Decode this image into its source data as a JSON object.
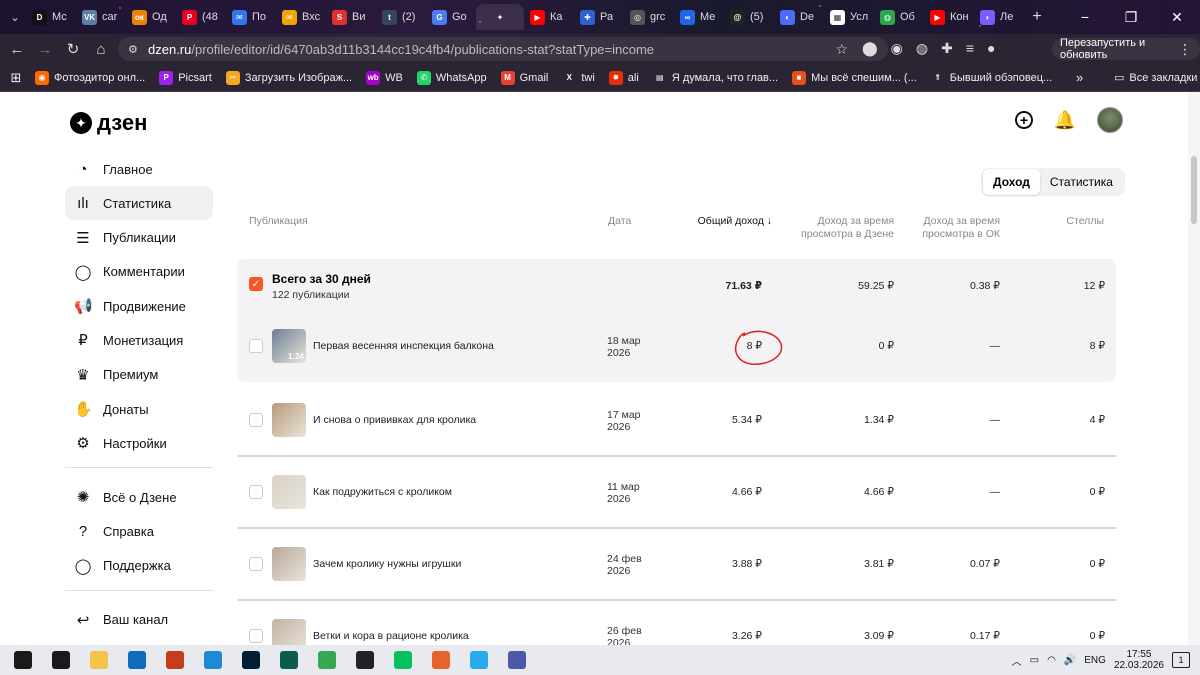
{
  "browser": {
    "tabs": [
      {
        "label": "Мс",
        "icon": "dzen-icon",
        "color": "#111111",
        "glyph": "D"
      },
      {
        "label": "car",
        "icon": "vk-icon",
        "color": "#5b7fa6",
        "glyph": "VK"
      },
      {
        "label": "Од",
        "icon": "ok-icon",
        "color": "#ee8208",
        "glyph": "ок"
      },
      {
        "label": "(48",
        "icon": "pinterest-icon",
        "color": "#e60023",
        "glyph": "P"
      },
      {
        "label": "По",
        "icon": "mail-icon",
        "color": "#3474f0",
        "glyph": "✉"
      },
      {
        "label": "Вхс",
        "icon": "yandex-mail-icon",
        "color": "#f0a500",
        "glyph": "✉"
      },
      {
        "label": "Ви",
        "icon": "s-icon",
        "color": "#e03030",
        "glyph": "S"
      },
      {
        "label": "(2)",
        "icon": "tumblr-icon",
        "color": "#35465c",
        "glyph": "t"
      },
      {
        "label": "Gо",
        "icon": "translate-icon",
        "color": "#4a7bf0",
        "glyph": "G"
      },
      {
        "label": "",
        "icon": "star-tab-icon",
        "color": "#3b2f4a",
        "glyph": "✦",
        "active": true
      },
      {
        "label": "Ка",
        "icon": "youtube-icon",
        "color": "#ff0000",
        "glyph": "▶"
      },
      {
        "label": "Ра",
        "icon": "puzzle-icon",
        "color": "#2a62d6",
        "glyph": "✚"
      },
      {
        "label": "grc",
        "icon": "grok-icon",
        "color": "#555555",
        "glyph": "◎"
      },
      {
        "label": "Ме",
        "icon": "meta-icon",
        "color": "#2166e8",
        "glyph": "∞"
      },
      {
        "label": "(5)",
        "icon": "threads-icon",
        "color": "#222222",
        "glyph": "@"
      },
      {
        "label": "De",
        "icon": "deepseek-icon",
        "color": "#4b6bfb",
        "glyph": "◐"
      },
      {
        "label": "Усл",
        "icon": "doc-icon",
        "color": "#ffffff",
        "glyph": "▦"
      },
      {
        "label": "Об",
        "icon": "apps-icon",
        "color": "#2ca84c",
        "glyph": "◍"
      },
      {
        "label": "Кон",
        "icon": "youtube-icon",
        "color": "#ff0000",
        "glyph": "▶"
      },
      {
        "label": "Ле",
        "icon": "alice-icon",
        "color": "#7b5cff",
        "glyph": "◗"
      }
    ],
    "url_host": "dzen.ru",
    "url_path": "/profile/editor/id/6470ab3d11b3144cc19c4fb4/publications-stat?statType=income",
    "relaunch_label": "Перезапустить и обновить",
    "bookmarks": [
      {
        "label": "Фотоэдитор онл...",
        "color": "#ff6a00",
        "glyph": "◉",
        "icon": "photo-editor-icon"
      },
      {
        "label": "Picsart",
        "color": "#a020f0",
        "glyph": "P",
        "icon": "picsart-icon"
      },
      {
        "label": "Загрузить Изображ...",
        "color": "#f5a623",
        "glyph": "✂",
        "icon": "scissors-icon"
      },
      {
        "label": "WB",
        "color": "#a300c8",
        "glyph": "wb",
        "icon": "wildberries-icon"
      },
      {
        "label": "WhatsApp",
        "color": "#25d366",
        "glyph": "✆",
        "icon": "whatsapp-icon"
      },
      {
        "label": "Gmail",
        "color": "#e94235",
        "glyph": "M",
        "icon": "gmail-icon"
      },
      {
        "label": "twi",
        "color": "#2b2533",
        "glyph": "X",
        "icon": "x-icon"
      },
      {
        "label": "ali",
        "color": "#e62e04",
        "glyph": "✸",
        "icon": "aliexpress-icon"
      },
      {
        "label": "Я думала, что глав...",
        "color": "#2b2533",
        "glyph": "▤",
        "icon": "grid-icon"
      },
      {
        "label": "Мы всё спешим... (...",
        "color": "#e8501a",
        "glyph": "■",
        "icon": "square-icon"
      },
      {
        "label": "Бывший обэповец...",
        "color": "#2b2533",
        "glyph": "⇑",
        "icon": "chevrons-icon"
      }
    ],
    "all_bookmarks_label": "Все закладки"
  },
  "app": {
    "logo_text": "дзен",
    "sidebar": [
      {
        "label": "Главное",
        "icon": "planet-icon",
        "glyph": "◔"
      },
      {
        "label": "Статистика",
        "icon": "bar-chart-icon",
        "glyph": "ılı",
        "active": true
      },
      {
        "label": "Публикации",
        "icon": "stack-icon",
        "glyph": "☰"
      },
      {
        "label": "Комментарии",
        "icon": "comment-icon",
        "glyph": "◯"
      },
      {
        "label": "Продвижение",
        "icon": "megaphone-icon",
        "glyph": "📢"
      },
      {
        "label": "Монетизация",
        "icon": "ruble-icon",
        "glyph": "₽"
      },
      {
        "label": "Премиум",
        "icon": "crown-icon",
        "glyph": "♛"
      },
      {
        "label": "Донаты",
        "icon": "hand-coin-icon",
        "glyph": "✋"
      },
      {
        "label": "Настройки",
        "icon": "gear-icon",
        "glyph": "⚙"
      }
    ],
    "sidebar_secondary": [
      {
        "label": "Всё о Дзене",
        "icon": "flame-icon",
        "glyph": "✺"
      },
      {
        "label": "Справка",
        "icon": "help-icon",
        "glyph": "?"
      },
      {
        "label": "Поддержка",
        "icon": "chat-icon",
        "glyph": "◯"
      }
    ],
    "sidebar_channel": {
      "label": "Ваш канал",
      "icon": "return-icon",
      "glyph": "↩"
    },
    "toggle": {
      "income": "Доход",
      "stats": "Статистика"
    }
  },
  "table": {
    "headers": {
      "publication": "Публикация",
      "date": "Дата",
      "total_income": "Общий доход",
      "dzen_view": "Доход за время\nпросмотра в Дзене",
      "ok_view": "Доход за время\nпросмотра в ОК",
      "stella": "Стеллы"
    },
    "total": {
      "title": "Всего за 30 дней",
      "subtitle": "122 публикации",
      "total_income": "71.63 ₽",
      "dzen_view": "59.25 ₽",
      "ok_view": "0.38 ₽",
      "stella": "12 ₽"
    },
    "rows": [
      {
        "title": "Первая весенняя инспекция балкона",
        "date_day": "18 мар",
        "date_year": "2026",
        "total_income": "8 ₽",
        "dzen_view": "0 ₽",
        "ok_view": "—",
        "stella": "8 ₽",
        "duration": "1:24",
        "thumb_color": "#6c7e93",
        "highlighted": true
      },
      {
        "title": "И снова о прививках для кролика",
        "date_day": "17 мар",
        "date_year": "2026",
        "total_income": "5.34 ₽",
        "dzen_view": "1.34 ₽",
        "ok_view": "—",
        "stella": "4 ₽",
        "thumb_color": "#b89a78"
      },
      {
        "title": "Как подружиться с кроликом",
        "date_day": "11 мар",
        "date_year": "2026",
        "total_income": "4.66 ₽",
        "dzen_view": "4.66 ₽",
        "ok_view": "—",
        "stella": "0 ₽",
        "thumb_color": "#d8d2c8"
      },
      {
        "title": "Зачем кролику нужны игрушки",
        "date_day": "24 фев",
        "date_year": "2026",
        "total_income": "3.88 ₽",
        "dzen_view": "3.81 ₽",
        "ok_view": "0.07 ₽",
        "stella": "0 ₽",
        "thumb_color": "#b8a89a"
      },
      {
        "title": "Ветки и кора в рационе кролика",
        "date_day": "26 фев",
        "date_year": "2026",
        "total_income": "3.26 ₽",
        "dzen_view": "3.09 ₽",
        "ok_view": "0.17 ₽",
        "stella": "0 ₽",
        "thumb_color": "#c4b2a0"
      }
    ]
  },
  "taskbar": {
    "apps": [
      {
        "icon": "start-icon",
        "color": "#1a1a1a"
      },
      {
        "icon": "task-view-icon",
        "color": "#1a1a1a"
      },
      {
        "icon": "file-explorer-icon",
        "color": "#f3c34b"
      },
      {
        "icon": "outlook-icon",
        "color": "#0f6cbd"
      },
      {
        "icon": "powerpoint-icon",
        "color": "#c43e1c"
      },
      {
        "icon": "edge-icon",
        "color": "#1e8ad6"
      },
      {
        "icon": "lightroom-icon",
        "color": "#001e36"
      },
      {
        "icon": "app-icon",
        "color": "#0b5c4b"
      },
      {
        "icon": "chrome-icon",
        "color": "#34a853"
      },
      {
        "icon": "settings-icon",
        "color": "#222222"
      },
      {
        "icon": "wechat-icon",
        "color": "#07c160"
      },
      {
        "icon": "browser-icon",
        "color": "#e8622c"
      },
      {
        "icon": "telegram-icon",
        "color": "#2aabee"
      },
      {
        "icon": "monitor-icon",
        "color": "#4a5aa8"
      }
    ],
    "lang": "ENG",
    "time": "17:55",
    "date": "22.03.2026",
    "notif_count": "1"
  }
}
